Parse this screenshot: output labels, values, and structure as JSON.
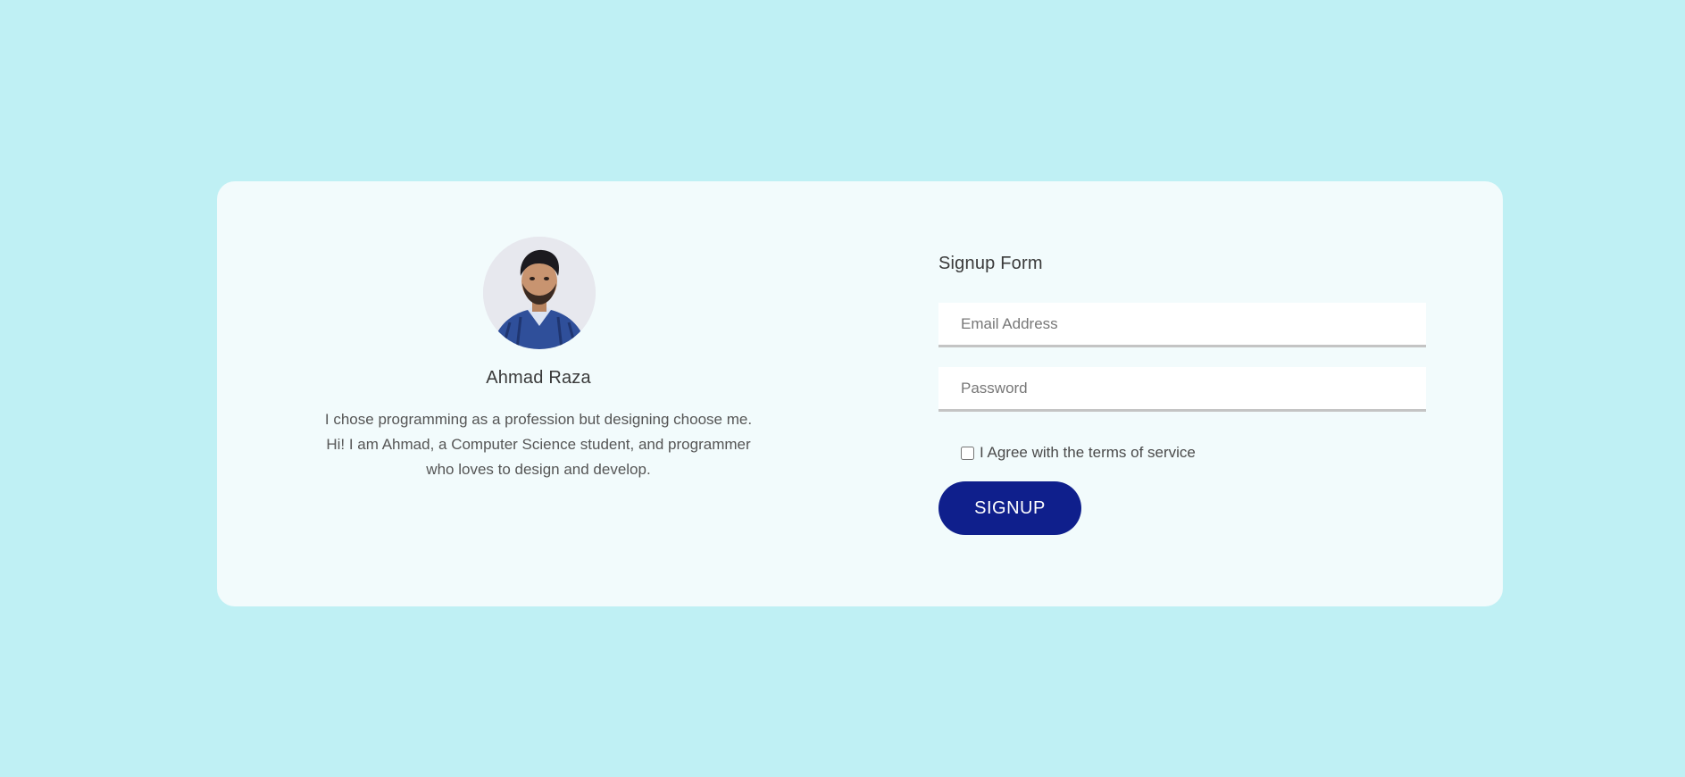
{
  "profile": {
    "avatar_alt": "Ahmad Raza profile photo",
    "name": "Ahmad Raza",
    "bio_lines": [
      "I chose programming as a profession but designing choose me.",
      "Hi! I am Ahmad, a Computer Science student, and programmer",
      "who loves to design and develop."
    ]
  },
  "form": {
    "title": "Signup Form",
    "email_placeholder": "Email Address",
    "password_placeholder": "Password",
    "agree_label": "I Agree with the terms of service",
    "agree_checked": false,
    "submit_label": "SIGNUP"
  },
  "colors": {
    "page_background": "#bff0f4",
    "card_background": "#f2fbfc",
    "button": "#0f1f8c"
  }
}
